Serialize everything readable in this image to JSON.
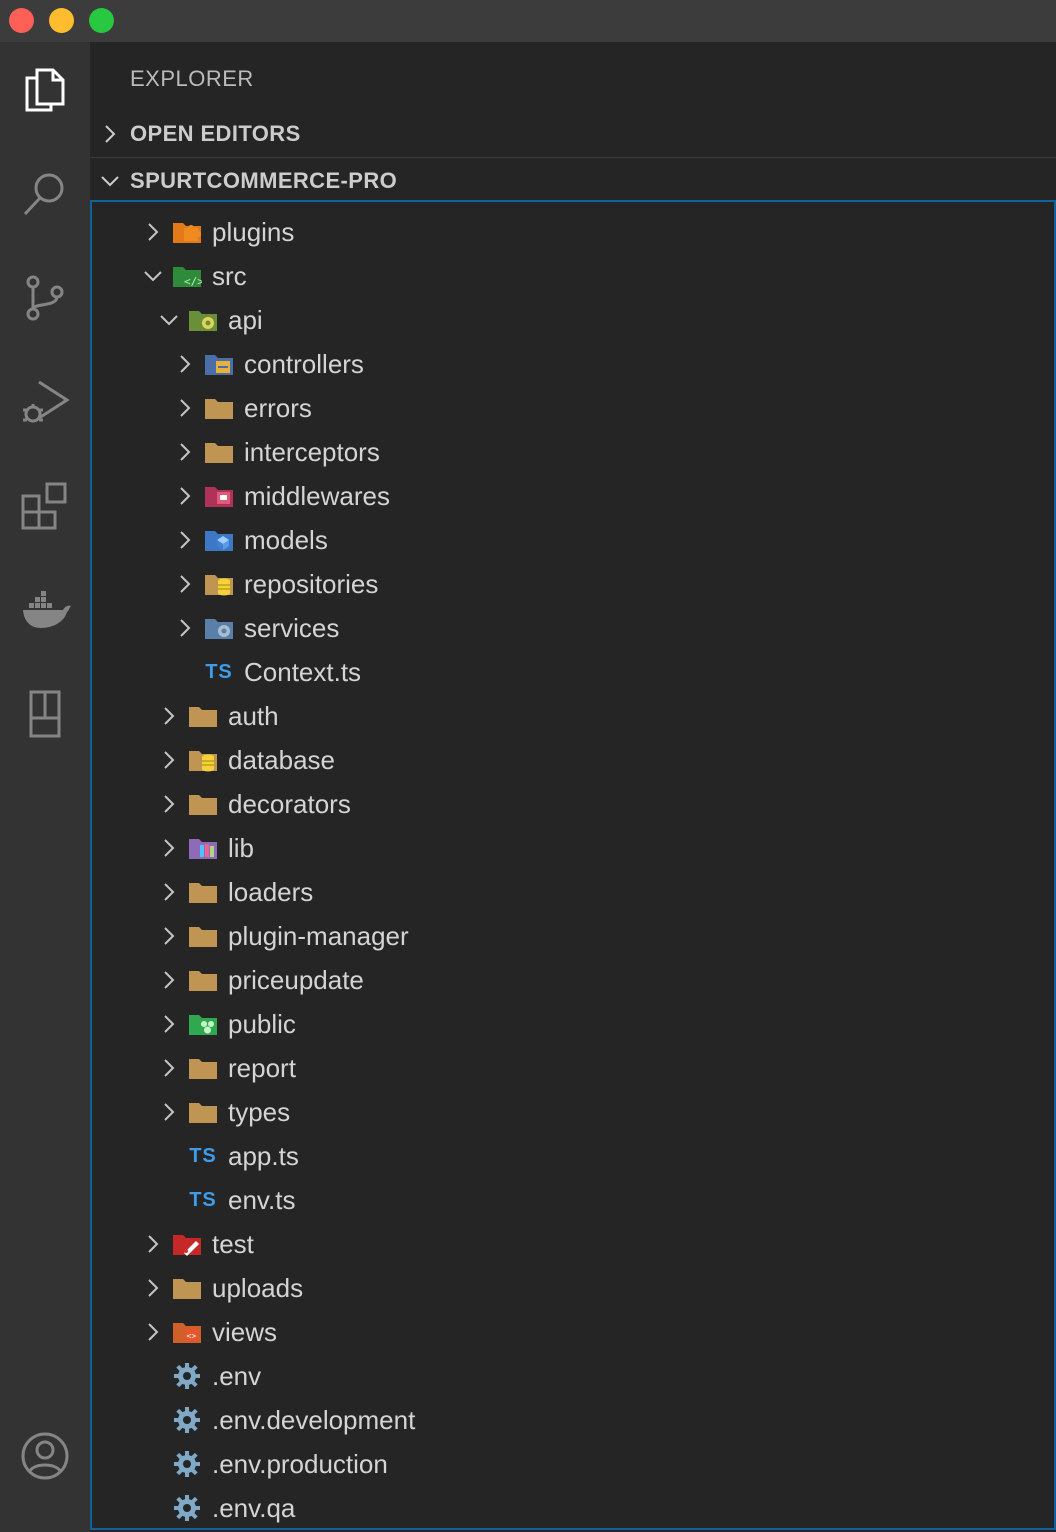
{
  "window": {
    "traffic_lights": [
      "close",
      "minimize",
      "zoom"
    ],
    "colors": {
      "close": "#fe5f57",
      "minimize": "#febc2e",
      "zoom": "#28c840"
    }
  },
  "activity_bar": {
    "items": [
      {
        "name": "explorer",
        "icon": "files-icon",
        "active": true
      },
      {
        "name": "search",
        "icon": "search-icon"
      },
      {
        "name": "source-control",
        "icon": "source-control-icon"
      },
      {
        "name": "run-debug",
        "icon": "run-debug-icon"
      },
      {
        "name": "extensions",
        "icon": "extensions-icon"
      },
      {
        "name": "docker",
        "icon": "docker-icon"
      },
      {
        "name": "remote",
        "icon": "remote-explorer-icon"
      },
      {
        "name": "accounts",
        "icon": "account-icon"
      }
    ]
  },
  "sidebar": {
    "title": "EXPLORER",
    "open_editors_label": "OPEN EDITORS",
    "project_label": "SPURTCOMMERCE-PRO",
    "tree": [
      {
        "label": "plugins",
        "depth": 0,
        "twisty": "closed",
        "icon": "plugins-folder-icon"
      },
      {
        "label": "src",
        "depth": 0,
        "twisty": "open",
        "icon": "src-folder-icon"
      },
      {
        "label": "api",
        "depth": 1,
        "twisty": "open",
        "icon": "api-folder-icon"
      },
      {
        "label": "controllers",
        "depth": 2,
        "twisty": "closed",
        "icon": "controllers-folder-icon"
      },
      {
        "label": "errors",
        "depth": 2,
        "twisty": "closed",
        "icon": "folder-icon"
      },
      {
        "label": "interceptors",
        "depth": 2,
        "twisty": "closed",
        "icon": "folder-icon"
      },
      {
        "label": "middlewares",
        "depth": 2,
        "twisty": "closed",
        "icon": "middlewares-folder-icon"
      },
      {
        "label": "models",
        "depth": 2,
        "twisty": "closed",
        "icon": "models-folder-icon"
      },
      {
        "label": "repositories",
        "depth": 2,
        "twisty": "closed",
        "icon": "database-folder-icon"
      },
      {
        "label": "services",
        "depth": 2,
        "twisty": "closed",
        "icon": "services-folder-icon"
      },
      {
        "label": "Context.ts",
        "depth": 2,
        "twisty": "none",
        "icon": "typescript-file-icon"
      },
      {
        "label": "auth",
        "depth": 1,
        "twisty": "closed",
        "icon": "folder-icon"
      },
      {
        "label": "database",
        "depth": 1,
        "twisty": "closed",
        "icon": "database-folder-icon"
      },
      {
        "label": "decorators",
        "depth": 1,
        "twisty": "closed",
        "icon": "folder-icon"
      },
      {
        "label": "lib",
        "depth": 1,
        "twisty": "closed",
        "icon": "lib-folder-icon"
      },
      {
        "label": "loaders",
        "depth": 1,
        "twisty": "closed",
        "icon": "folder-icon"
      },
      {
        "label": "plugin-manager",
        "depth": 1,
        "twisty": "closed",
        "icon": "folder-icon"
      },
      {
        "label": "priceupdate",
        "depth": 1,
        "twisty": "closed",
        "icon": "folder-icon"
      },
      {
        "label": "public",
        "depth": 1,
        "twisty": "closed",
        "icon": "public-folder-icon"
      },
      {
        "label": "report",
        "depth": 1,
        "twisty": "closed",
        "icon": "folder-icon"
      },
      {
        "label": "types",
        "depth": 1,
        "twisty": "closed",
        "icon": "folder-icon"
      },
      {
        "label": "app.ts",
        "depth": 1,
        "twisty": "none",
        "icon": "typescript-file-icon"
      },
      {
        "label": "env.ts",
        "depth": 1,
        "twisty": "none",
        "icon": "typescript-file-icon"
      },
      {
        "label": "test",
        "depth": 0,
        "twisty": "closed",
        "icon": "test-folder-icon"
      },
      {
        "label": "uploads",
        "depth": 0,
        "twisty": "closed",
        "icon": "folder-icon"
      },
      {
        "label": "views",
        "depth": 0,
        "twisty": "closed",
        "icon": "views-folder-icon"
      },
      {
        "label": ".env",
        "depth": 0,
        "twisty": "none",
        "icon": "settings-gear-icon"
      },
      {
        "label": ".env.development",
        "depth": 0,
        "twisty": "none",
        "icon": "settings-gear-icon"
      },
      {
        "label": ".env.production",
        "depth": 0,
        "twisty": "none",
        "icon": "settings-gear-icon"
      },
      {
        "label": ".env.qa",
        "depth": 0,
        "twisty": "none",
        "icon": "settings-gear-icon"
      }
    ],
    "ts_badge": "TS"
  }
}
